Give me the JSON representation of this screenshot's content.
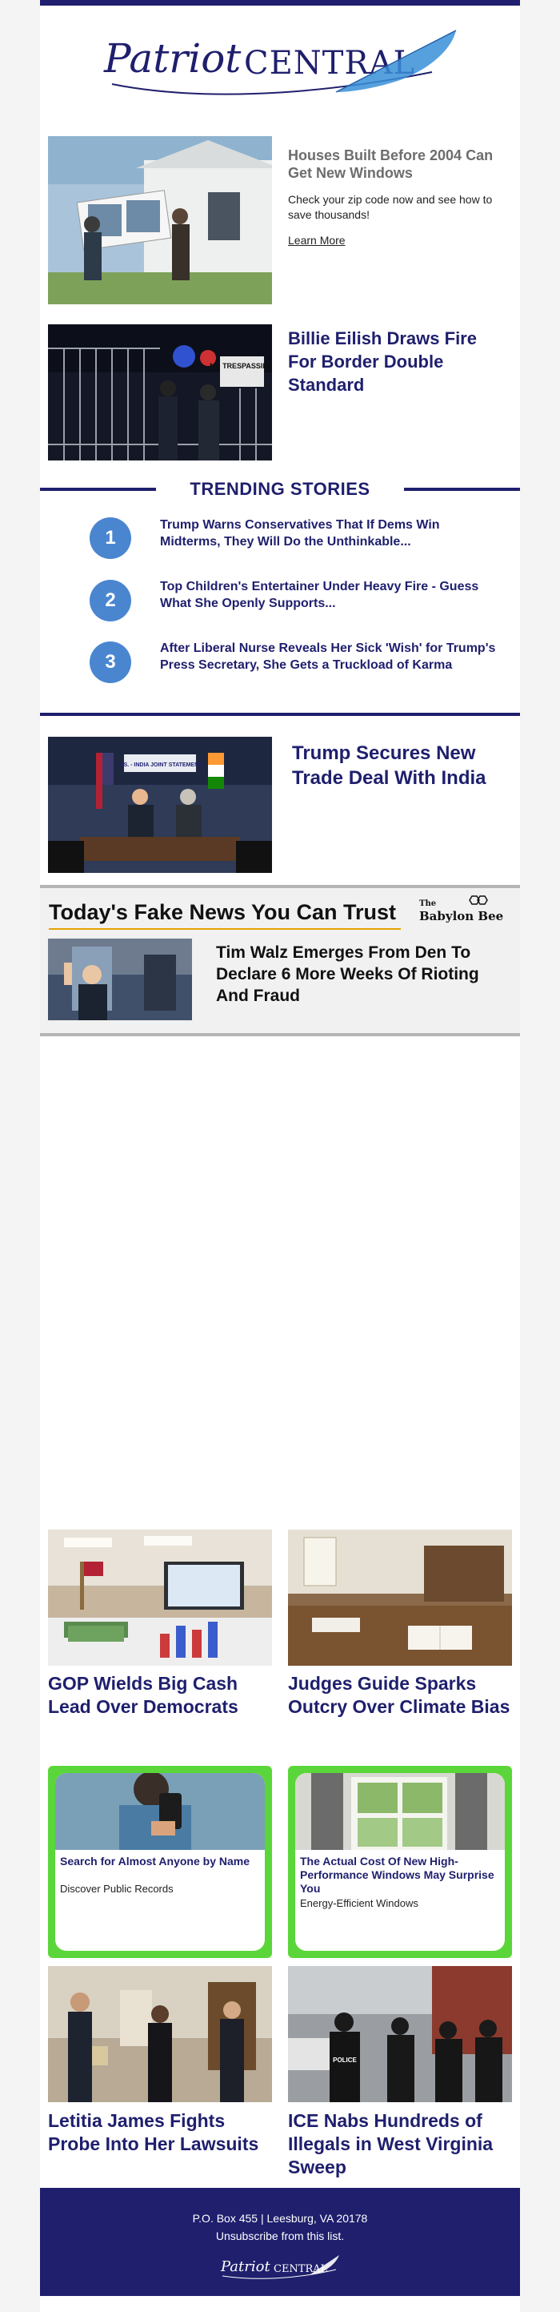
{
  "brand": {
    "logo_word_1": "Patriot",
    "logo_word_2": "CENTRAL",
    "navy": "#1f1f6e",
    "accent_blue": "#4a86d0",
    "promo_green": "#5ad63a"
  },
  "sponsored_windows": {
    "title": "Houses Built Before 2004 Can Get New Windows",
    "text": "Check your zip code now and see how to save thousands!",
    "link_label": "Learn More"
  },
  "story_billie": {
    "headline": "Billie Eilish Draws Fire For Border Double Standard",
    "photo_sign_text": "NO TRESPASSING"
  },
  "trending": {
    "title": "TRENDING STORIES",
    "items": [
      {
        "num": "1",
        "text": "Trump Warns Conservatives That If Dems Win Midterms, They Will Do the Unthinkable..."
      },
      {
        "num": "2",
        "text": "Top Children's Entertainer Under Heavy Fire - Guess What She Openly Supports..."
      },
      {
        "num": "3",
        "text": "After Liberal Nurse Reveals Her Sick 'Wish' for Trump's Press Secretary, She Gets a Truckload of Karma"
      }
    ]
  },
  "story_trade": {
    "headline": "Trump Secures New Trade Deal With India",
    "photo_banner_text": "U.S. - INDIA JOINT STATEMENT"
  },
  "babylon_bee": {
    "section_title": "Today's Fake News You Can Trust",
    "logo_small": "The",
    "logo_large": "Babylon Bee",
    "headline": "Tim Walz Emerges From Den To Declare 6 More Weeks Of Rioting And Fraud"
  },
  "grid_top": [
    {
      "headline": "GOP Wields Big Cash Lead Over Democrats"
    },
    {
      "headline": "Judges Guide Sparks Outcry Over Climate Bias"
    }
  ],
  "promos": [
    {
      "title": "Search for Almost Anyone by Name",
      "subtitle": "Discover Public Records"
    },
    {
      "title": "The Actual Cost Of New High-Performance Windows May Surprise You",
      "subtitle": "Energy-Efficient Windows"
    }
  ],
  "grid_bottom": [
    {
      "headline": "Letitia James Fights Probe Into Her Lawsuits"
    },
    {
      "headline": "ICE Nabs Hundreds of Illegals in West Virginia Sweep",
      "photo_vest_text": "POLICE"
    }
  ],
  "footer": {
    "address": "P.O. Box 455 | Leesburg, VA 20178",
    "unsubscribe": "Unsubscribe from this list.",
    "logo_word_1": "Patriot",
    "logo_word_2": "CENTRAL"
  }
}
